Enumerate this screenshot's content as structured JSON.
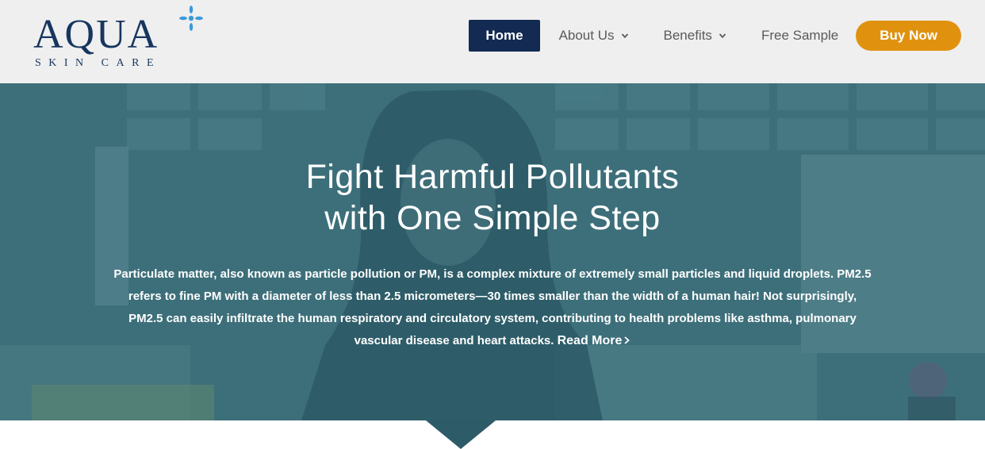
{
  "brand": {
    "logo_word": "AQUA",
    "logo_sub": "SKIN CARE",
    "color": "#17365f",
    "star_color": "#3a9ad9"
  },
  "nav": {
    "items": [
      {
        "label": "Home",
        "active": true,
        "dropdown": false
      },
      {
        "label": "About Us",
        "active": false,
        "dropdown": true
      },
      {
        "label": "Benefits",
        "active": false,
        "dropdown": true
      },
      {
        "label": "Free Sample",
        "active": false,
        "dropdown": false
      }
    ],
    "cta": "Buy Now",
    "active_bg": "#132a53",
    "cta_bg": "#e0920f"
  },
  "hero": {
    "title_line1": "Fight Harmful Pollutants",
    "title_line2": "with One Simple Step",
    "body": "Particulate matter, also known as particle pollution or PM, is a complex mixture of extremely small particles and liquid droplets. PM2.5 refers to fine PM with a diameter of less than 2.5 micrometers—30 times smaller than the width of a human hair!  Not surprisingly, PM2.5 can easily infiltrate the human respiratory and circulatory system, contributing to health problems like asthma, pulmonary vascular disease and heart attacks.",
    "read_more": "Read More",
    "overlay_color": "#3f6f7b"
  }
}
